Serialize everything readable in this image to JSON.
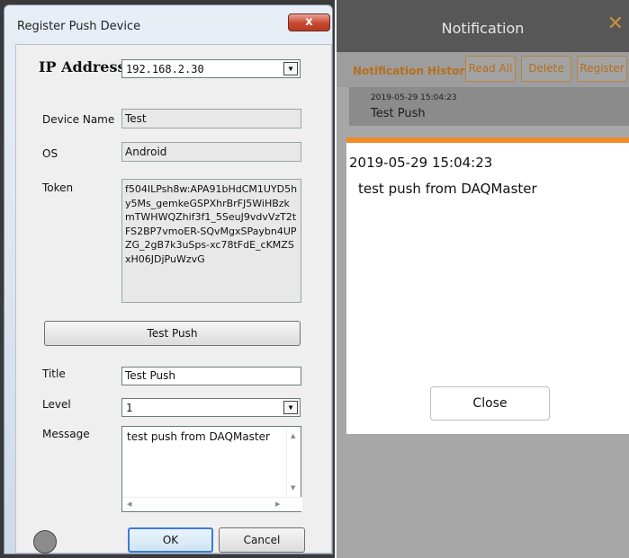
{
  "dialog": {
    "title": "Register Push Device",
    "close_glyph": "x",
    "ip_label": "IP Address",
    "ip_value": "192.168.2.30",
    "device_name_label": "Device Name",
    "device_name_value": "Test",
    "os_label": "OS",
    "os_value": "Android",
    "token_label": "Token",
    "token_value": "f504ILPsh8w:APA91bHdCM1UYD5hy5Ms_gemkeGSPXhrBrFJ5WiHBzkmTWHWQZhif3f1_5SeuJ9vdvVzT2tFS2BP7vmoER-SQvMgxSPaybn4UPZG_2gB7k3uSps-xc78tFdE_cKMZSxH06JDjPuWzvG",
    "test_push_label": "Test Push",
    "title_label": "Title",
    "title_value": "Test Push",
    "level_label": "Level",
    "level_value": "1",
    "message_label": "Message",
    "message_value": "test push from DAQMaster",
    "ok_label": "OK",
    "cancel_label": "Cancel"
  },
  "app": {
    "title": "Notification",
    "close_glyph": "✕",
    "history_label": "Notification History",
    "buttons": [
      "Read All",
      "Delete",
      "Register"
    ],
    "history_item": {
      "time": "2019-05-29 15:04:23",
      "title": "Test Push"
    },
    "popup": {
      "time": "2019-05-29 15:04:23",
      "message": "test push from DAQMaster",
      "close_label": "Close"
    },
    "accent_color": "#f08c2a"
  }
}
